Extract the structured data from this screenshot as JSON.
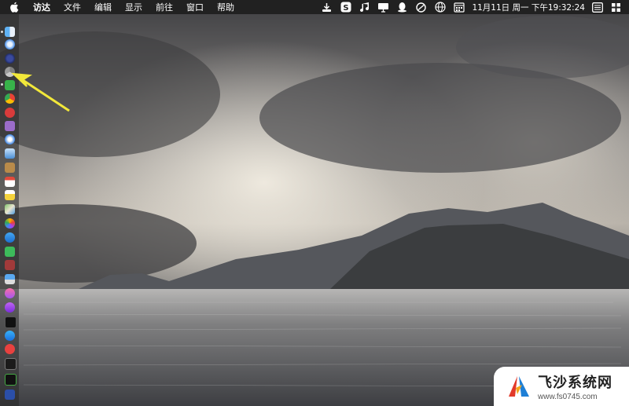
{
  "menubar": {
    "items": [
      "访达",
      "文件",
      "编辑",
      "显示",
      "前往",
      "窗口",
      "帮助"
    ],
    "clock": "11月11日 周一 下午19:32:24"
  },
  "tray_icons": [
    "download-icon",
    "s-app-icon",
    "music-note-icon",
    "display-icon",
    "qq-penguin-icon",
    "no-entry-icon",
    "globe-icon",
    "calendar-icon",
    "notification-icon",
    "menu-extra-icon"
  ],
  "dock_icons": [
    "finder-icon",
    "safari-icon",
    "launchpad-icon",
    "chrome-icon",
    "app-red-icon",
    "photos-icon",
    "safari-compass-icon",
    "preview-icon",
    "notes-brown-icon",
    "calendar-icon",
    "stickies-icon",
    "maps-icon",
    "photos-pinwheel-icon",
    "browser-blue-icon",
    "messages-icon",
    "photobooth-icon",
    "tv-icon",
    "music-icon",
    "podcasts-icon",
    "apple-tv-icon",
    "app-store-icon",
    "vivaldi-icon",
    "terminal-icon",
    "activity-monitor-icon",
    "vpn-icon"
  ],
  "watermark": {
    "title": "飞沙系统网",
    "url": "www.fs0745.com"
  },
  "colors": {
    "menubar": "#1e1e1e",
    "arrow": "#f2e83a"
  }
}
